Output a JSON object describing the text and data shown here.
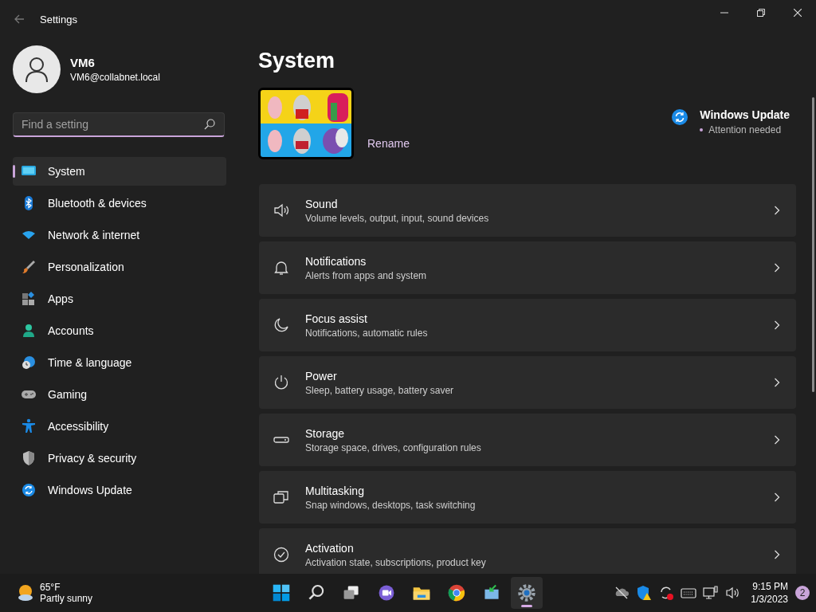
{
  "window": {
    "title": "Settings"
  },
  "account": {
    "name": "VM6",
    "email": "VM6@collabnet.local"
  },
  "search": {
    "placeholder": "Find a setting"
  },
  "sidebar": {
    "items": [
      {
        "label": "System",
        "selected": true
      },
      {
        "label": "Bluetooth & devices",
        "selected": false
      },
      {
        "label": "Network & internet",
        "selected": false
      },
      {
        "label": "Personalization",
        "selected": false
      },
      {
        "label": "Apps",
        "selected": false
      },
      {
        "label": "Accounts",
        "selected": false
      },
      {
        "label": "Time & language",
        "selected": false
      },
      {
        "label": "Gaming",
        "selected": false
      },
      {
        "label": "Accessibility",
        "selected": false
      },
      {
        "label": "Privacy & security",
        "selected": false
      },
      {
        "label": "Windows Update",
        "selected": false
      }
    ]
  },
  "page": {
    "title": "System",
    "rename": "Rename",
    "update": {
      "title": "Windows Update",
      "status": "Attention needed"
    }
  },
  "cards": [
    {
      "title": "Sound",
      "subtitle": "Volume levels, output, input, sound devices"
    },
    {
      "title": "Notifications",
      "subtitle": "Alerts from apps and system"
    },
    {
      "title": "Focus assist",
      "subtitle": "Notifications, automatic rules"
    },
    {
      "title": "Power",
      "subtitle": "Sleep, battery usage, battery saver"
    },
    {
      "title": "Storage",
      "subtitle": "Storage space, drives, configuration rules"
    },
    {
      "title": "Multitasking",
      "subtitle": "Snap windows, desktops, task switching"
    },
    {
      "title": "Activation",
      "subtitle": "Activation state, subscriptions, product key"
    }
  ],
  "taskbar": {
    "weather": {
      "temperature": "65°F",
      "condition": "Partly sunny"
    },
    "apps": [
      {
        "selected": false
      },
      {
        "selected": false
      },
      {
        "selected": false
      },
      {
        "selected": false
      },
      {
        "selected": false
      },
      {
        "selected": false
      },
      {
        "selected": false
      },
      {
        "selected": true
      }
    ],
    "clock": {
      "time": "9:15 PM",
      "date": "1/3/2023"
    },
    "notifications": "2"
  }
}
